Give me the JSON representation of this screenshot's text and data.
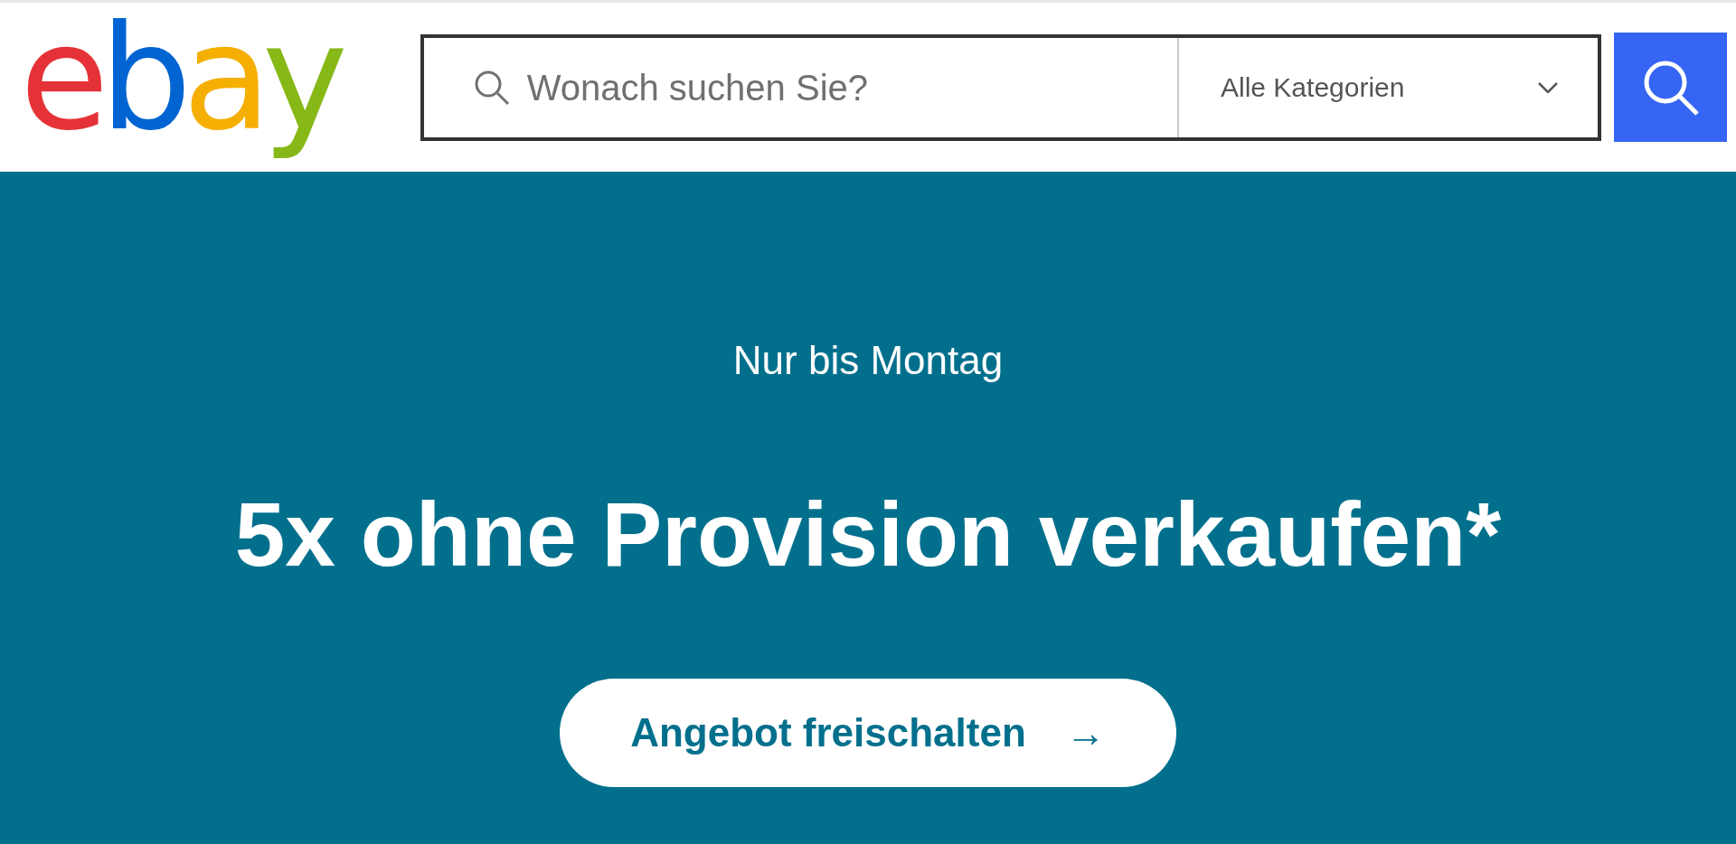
{
  "header": {
    "logo": [
      {
        "letter": "e",
        "color": "#e53238"
      },
      {
        "letter": "b",
        "color": "#0064d2"
      },
      {
        "letter": "a",
        "color": "#f5af02"
      },
      {
        "letter": "y",
        "color": "#86b817"
      }
    ],
    "search": {
      "placeholder": "Wonach suchen Sie?"
    },
    "category": {
      "label": "Alle Kategorien"
    }
  },
  "banner": {
    "eyebrow": "Nur bis Montag",
    "headline": "5x ohne Provision verkaufen*",
    "button": {
      "label": "Angebot freischalten",
      "arrow": "→"
    }
  }
}
